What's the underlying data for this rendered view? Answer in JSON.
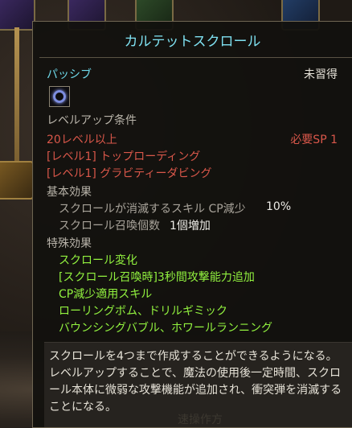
{
  "tooltip": {
    "title": "カルテットスクロール",
    "type": "パッシブ",
    "status": "未習得",
    "skill_icon": "ring-orb-icon",
    "levelup_header": "レベルアップ条件",
    "level_req": "20レベル以上",
    "sp_req": "必要SP 1",
    "prereq_1": "[レベル1] トップローディング",
    "prereq_2": "[レベル1] グラビティーダビング",
    "basic_header": "基本効果",
    "basic_1_label": "スクロールが消滅するスキル CP減少",
    "basic_1_value": "10%",
    "basic_2_label": "スクロール召喚個数",
    "basic_2_value": "1個増加",
    "special_header": "特殊効果",
    "special": [
      "スクロール変化",
      "[スクロール召喚時]3秒間攻撃能力追加",
      "CP減少適用スキル",
      "ローリングボム、ドリルギミック",
      "バウンシングバブル、ホワールランニング"
    ],
    "description": "スクロールを4つまで作成することができるようになる。レベルアップすることで、魔法の使用後一定時間、スクロール本体に微弱な攻撃機能が追加され、衝突弾を消滅することになる。",
    "footer_partial": "速操作方"
  },
  "colors": {
    "title": "#7fe1f1",
    "requirement_red": "#d9574a",
    "special_green": "#92f23f"
  }
}
